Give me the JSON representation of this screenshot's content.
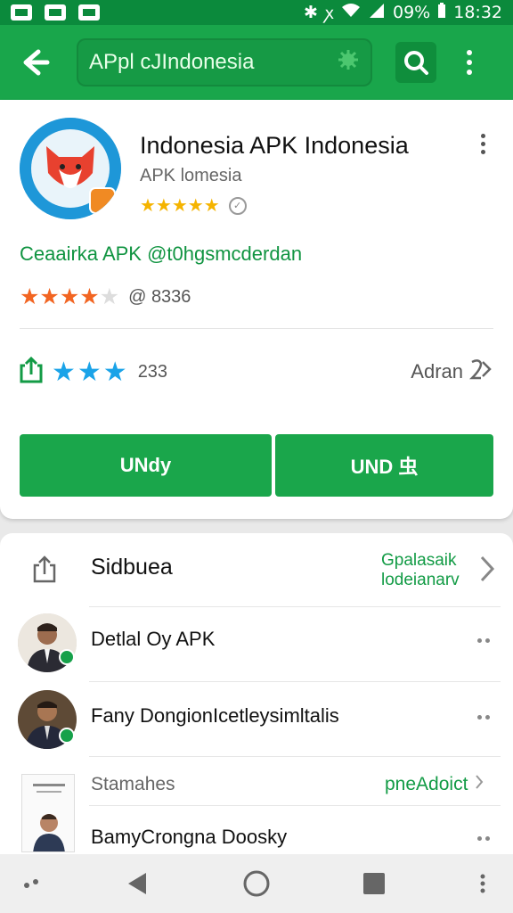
{
  "status_bar": {
    "battery_text": "09%",
    "time": "18:32"
  },
  "app_bar": {
    "search_query": "APpl cJIndonesia"
  },
  "app_card": {
    "title": "Indonesia APK Indonesia",
    "developer": "APK lomesia",
    "stars_text": "★★★★★",
    "link_text": "Ceaairka APK @t0hgsmcderdan",
    "rating_stars": "★★★★",
    "rating_dim_star": "★",
    "rating_count": "@ 8336",
    "share_stars": "★★★",
    "share_count": "233",
    "adran_label": "Adran",
    "buttons": [
      "UNdy",
      "UND 虫"
    ]
  },
  "section": {
    "title": "Sidbuea",
    "right_line1": "Gpalasaik",
    "right_line2": "lodeianarv",
    "rows": [
      {
        "label": "Detlal Oy APK"
      },
      {
        "label": "Fany DongionIcetleysimltalis"
      }
    ],
    "subhead_left": "Stamahes",
    "subhead_right": "pneAdoict",
    "last_row_label": "BamyCrongna Doosky"
  },
  "colors": {
    "brand_green": "#19a64b",
    "status_green": "#0b8a3c",
    "star_gold": "#f5b400",
    "star_orange": "#f26522",
    "star_blue": "#1aa3e8"
  }
}
